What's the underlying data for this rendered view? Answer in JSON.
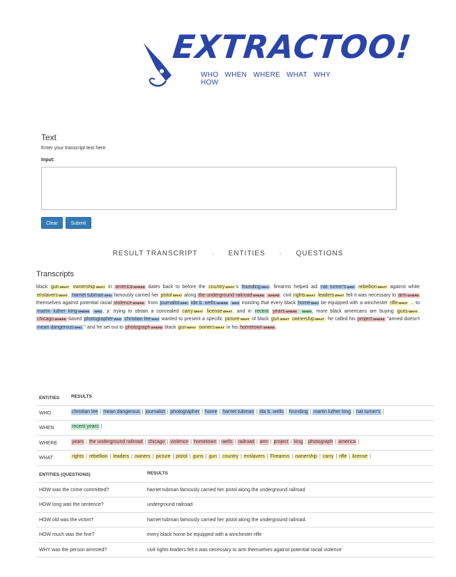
{
  "logo": {
    "title": "EXTRACTOO!",
    "subtitle": "WHO WHEN WHERE WHAT WHY HOW"
  },
  "form": {
    "heading": "Text",
    "hint": "Enter your transcript text here",
    "input_label": "Input:",
    "input_value": "",
    "clear_label": "Clear",
    "submit_label": "Submit"
  },
  "tabs": [
    "RESULT TRANSCRIPT",
    "ENTITIES",
    "QUESTIONS"
  ],
  "tab_separator": "·",
  "colors": {
    "what": "#fff7b3",
    "where": "#f6c6c6",
    "who": "#b7d1f4",
    "when": "#bfeed0",
    "button": "#337ab7",
    "logo": "#2a44a8"
  },
  "transcripts": {
    "heading": "Transcripts",
    "segments": [
      {
        "t": "black "
      },
      {
        "t": "gun",
        "c": "what",
        "tag": "WHAT"
      },
      {
        "t": " "
      },
      {
        "t": "ownership",
        "c": "what",
        "tag": "WHAT"
      },
      {
        "t": " in "
      },
      {
        "t": "america",
        "c": "where",
        "tag": "WHERE"
      },
      {
        "t": " dates back to before the "
      },
      {
        "t": "country",
        "c": "what",
        "tag": "WHAT"
      },
      {
        "t": "'s "
      },
      {
        "t": "founding",
        "c": "who",
        "tag": "WHO"
      },
      {
        "t": ". firearms helped aid "
      },
      {
        "t": "nat turner's",
        "c": "who",
        "tag": "WHO"
      },
      {
        "t": " "
      },
      {
        "t": "rebellion",
        "c": "what",
        "tag": "WHAT"
      },
      {
        "t": " against white "
      },
      {
        "t": "enslavers",
        "c": "what",
        "tag": "WHAT"
      },
      {
        "t": ". "
      },
      {
        "t": "harriet tubman",
        "c": "who",
        "tag": "WHO"
      },
      {
        "t": " famously carried her "
      },
      {
        "t": "pistol",
        "c": "what",
        "tag": "WHAT"
      },
      {
        "t": " along "
      },
      {
        "t": "the underground railroad",
        "c": "where",
        "tag": "WHERE"
      },
      {
        "t": " "
      },
      {
        "t": "",
        "c": "where",
        "tag": "WHERE"
      },
      {
        "t": ". civil "
      },
      {
        "t": "rights",
        "c": "what",
        "tag": "WHAT"
      },
      {
        "t": " "
      },
      {
        "t": "leaders",
        "c": "what",
        "tag": "WHAT"
      },
      {
        "t": " felt it was necessary to "
      },
      {
        "t": "arm",
        "c": "where",
        "tag": "WHERE"
      },
      {
        "t": " themselves against potential racial "
      },
      {
        "t": "violence",
        "c": "where",
        "tag": "WHERE"
      },
      {
        "t": ": from "
      },
      {
        "t": "journalist",
        "c": "who",
        "tag": "WHO"
      },
      {
        "t": " "
      },
      {
        "t": "ida b. wells",
        "c": "who",
        "tag": "WHERE"
      },
      {
        "t": " "
      },
      {
        "t": "",
        "c": "who",
        "tag": "WHO"
      },
      {
        "t": " insisting that every black "
      },
      {
        "t": "home",
        "c": "who",
        "tag": "WHO"
      },
      {
        "t": " be equipped with a winchester "
      },
      {
        "t": "rifle",
        "c": "what",
        "tag": "WHAT"
      },
      {
        "t": " ... to "
      },
      {
        "t": "martin luther king",
        "c": "who",
        "tag": "WHERE"
      },
      {
        "t": " "
      },
      {
        "t": "",
        "c": "who",
        "tag": "WHO"
      },
      {
        "t": ", jr. trying to obtain a concealed "
      },
      {
        "t": "carry",
        "c": "what",
        "tag": "WHAT"
      },
      {
        "t": " "
      },
      {
        "t": "license",
        "c": "what",
        "tag": "WHAT"
      },
      {
        "t": ". and in "
      },
      {
        "t": "recent",
        "c": "when",
        "tag": ""
      },
      {
        "t": " "
      },
      {
        "t": "years",
        "c": "where",
        "tag": "WHERE"
      },
      {
        "t": " ",
        "c": "when",
        "tag": "WHEN"
      },
      {
        "t": ", more black americans are buying "
      },
      {
        "t": "guns",
        "c": "what",
        "tag": "WHAT"
      },
      {
        "t": ". "
      },
      {
        "t": "chicago",
        "c": "where",
        "tag": "WHERE"
      },
      {
        "t": "-based "
      },
      {
        "t": "photographer",
        "c": "who",
        "tag": "WHO"
      },
      {
        "t": " "
      },
      {
        "t": "christian lee",
        "c": "who",
        "tag": "WHO"
      },
      {
        "t": " wanted to present a specific "
      },
      {
        "t": "picture",
        "c": "what",
        "tag": "WHAT"
      },
      {
        "t": " of black "
      },
      {
        "t": "gun",
        "c": "what",
        "tag": "WHAT"
      },
      {
        "t": " "
      },
      {
        "t": "ownership",
        "c": "what",
        "tag": "WHAT"
      },
      {
        "t": ". he called his "
      },
      {
        "t": "project",
        "c": "where",
        "tag": "WHERE"
      },
      {
        "t": " \"armed doesn't "
      },
      {
        "t": "mean dangerous",
        "c": "who",
        "tag": "WHO"
      },
      {
        "t": ".\" and he set out to "
      },
      {
        "t": "photograph",
        "c": "where",
        "tag": "WHERE"
      },
      {
        "t": " black "
      },
      {
        "t": "gun",
        "c": "what",
        "tag": "WHAT"
      },
      {
        "t": " "
      },
      {
        "t": "owners",
        "c": "what",
        "tag": "WHAT"
      },
      {
        "t": " in his "
      },
      {
        "t": "hometown",
        "c": "where",
        "tag": "WHERE"
      },
      {
        "t": "."
      }
    ]
  },
  "entities": {
    "header": [
      "ENTITIES",
      "RESULTS"
    ],
    "rows": [
      {
        "label": "WHO",
        "c": "who",
        "items": [
          "christian lee",
          "mean dangerous",
          "journalist",
          "photographer",
          "home",
          "harriet tubman",
          "ida b. wells",
          "founding",
          "martin luther king",
          "nat turner's"
        ]
      },
      {
        "label": "WHEN",
        "c": "when",
        "items": [
          "recent years"
        ]
      },
      {
        "label": "WHERE",
        "c": "where",
        "items": [
          "years",
          "the underground railroad",
          "chicago",
          "violence",
          "hometown",
          "wells",
          "railroad",
          "arm",
          "project",
          "king",
          "photograph",
          "america"
        ]
      },
      {
        "label": "WHAT",
        "c": "what",
        "items": [
          "rights",
          "rebellion",
          "leaders",
          "owners",
          "picture",
          "pistol",
          "guns",
          "gun",
          "country",
          "enslavers",
          "Firearms",
          "ownership",
          "carry",
          "rifle",
          "license"
        ]
      }
    ]
  },
  "questions": {
    "header": [
      "ENTITIES (QUESTIONS)",
      "RESULTS"
    ],
    "rows": [
      {
        "q": "HOW was the crime committed?",
        "a": "harriet tubman famously carried her pistol along the underground railroad"
      },
      {
        "q": "HOW long was the sentence?",
        "a": "underground railroad."
      },
      {
        "q": "HOW old was the victim?",
        "a": "harriet tubman famously carried her pistol along the underground railroad."
      },
      {
        "q": "HOW much was the fine?",
        "a": "every black home be equipped with a winchester rifle"
      },
      {
        "q": "WHY was the person arrested?",
        "a": "civil rights leaders felt it was necessary to arm themselves against potential racial violence"
      }
    ]
  }
}
